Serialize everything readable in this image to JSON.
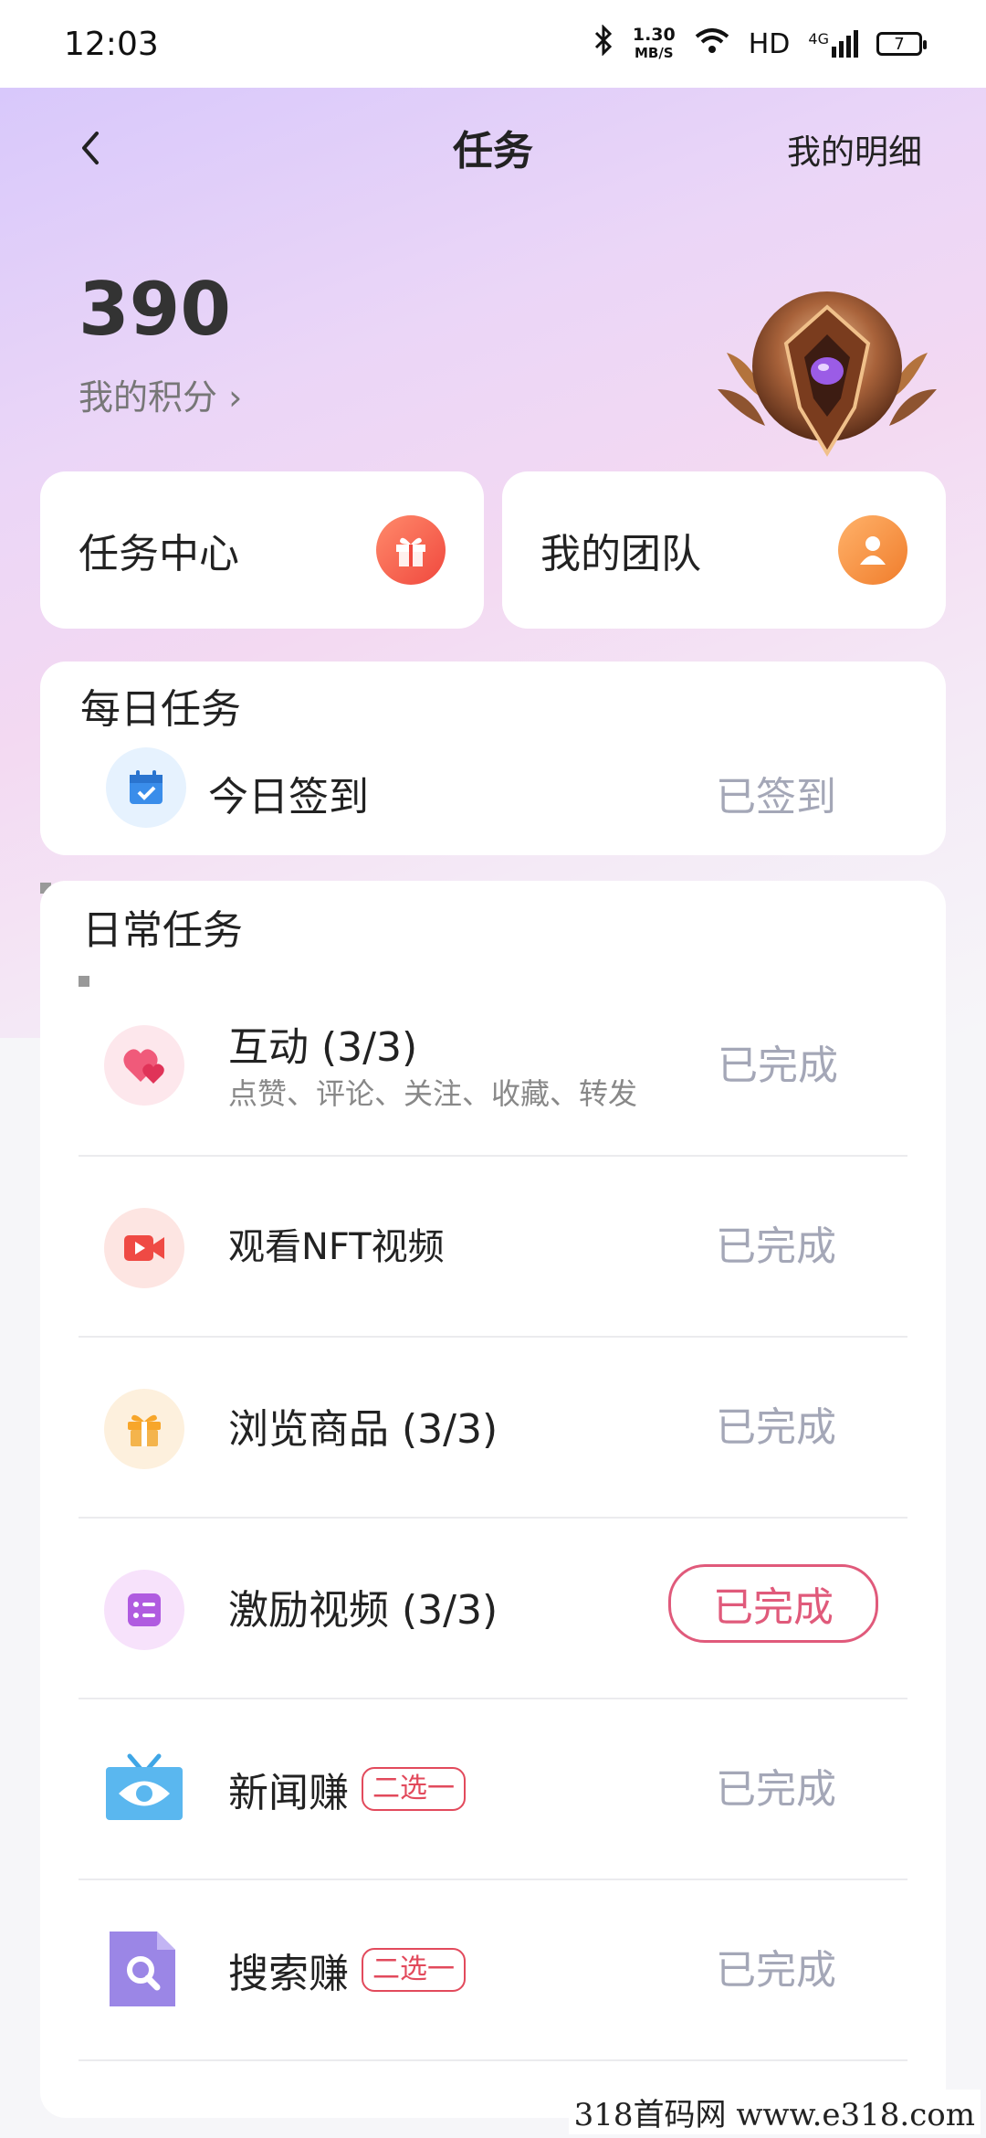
{
  "status_bar": {
    "time": "12:03",
    "speed_value": "1.30",
    "speed_unit": "MB/S",
    "hd": "HD",
    "network": "4G",
    "battery": "7"
  },
  "header": {
    "title": "任务",
    "detail_link": "我的明细"
  },
  "points": {
    "value": "390",
    "label": "我的积分 ›"
  },
  "quick_cards": [
    {
      "label": "任务中心",
      "icon": "gift-icon"
    },
    {
      "label": "我的团队",
      "icon": "user-icon"
    }
  ],
  "daily": {
    "title": "每日任务",
    "task": {
      "name": "今日签到",
      "status": "已签到",
      "icon": "calendar-icon"
    }
  },
  "regular": {
    "title": "日常任务",
    "tasks": [
      {
        "name": "互动 (3/3)",
        "sub": "点赞、评论、关注、收藏、转发",
        "status": "已完成",
        "icon": "heart-icon"
      },
      {
        "name": "观看NFT视频",
        "status": "已完成",
        "icon": "video-icon"
      },
      {
        "name": "浏览商品 (3/3)",
        "status": "已完成",
        "icon": "gift-icon"
      },
      {
        "name": "激励视频 (3/3)",
        "status": "已完成",
        "icon": "list-icon"
      },
      {
        "name": "新闻赚",
        "tag": "二选一",
        "status": "已完成",
        "icon": "tv-eye-icon"
      },
      {
        "name": "搜索赚",
        "tag": "二选一",
        "status": "已完成",
        "icon": "search-doc-icon"
      }
    ]
  },
  "watermark": "318首码网  www.e318.com",
  "colors": {
    "accent": "#e05a7b",
    "status_gray": "#a4a7b7",
    "tag_red": "#e24a5c"
  }
}
